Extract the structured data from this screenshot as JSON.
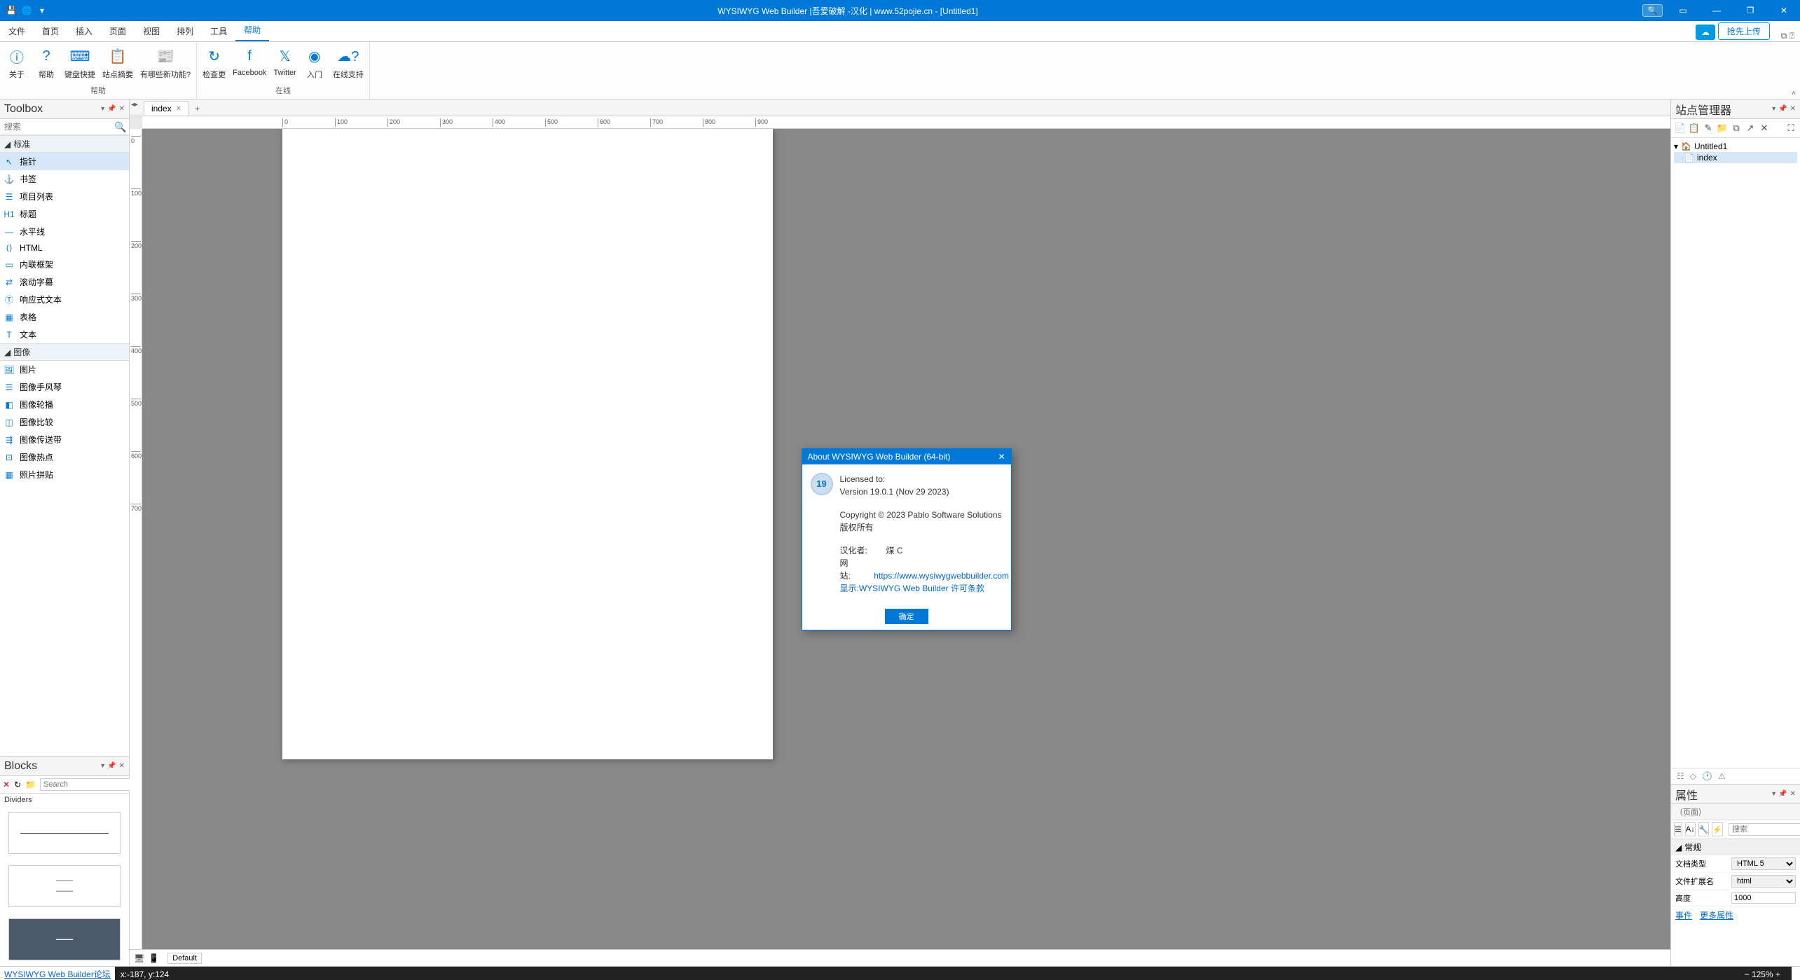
{
  "titlebar": {
    "title": "WYSIWYG Web Builder |吾爱破解 -汉化 | www.52pojie.cn - [Untitled1]"
  },
  "menu": {
    "file": "文件",
    "home": "首页",
    "insert": "插入",
    "page": "页面",
    "view": "视图",
    "arrange": "排列",
    "tools": "工具",
    "help": "帮助",
    "upload_label": "抢先上传"
  },
  "ribbon": {
    "group_help": "帮助",
    "group_online": "在线",
    "about": "关于",
    "help": "帮助",
    "shortcuts": "键盘快捷",
    "summary": "站点摘要",
    "whatsnew": "有哪些新功能?",
    "checkupdate": "检查更",
    "facebook": "Facebook",
    "twitter": "Twitter",
    "getting": "入门",
    "support": "在线支持"
  },
  "toolbox": {
    "title": "Toolbox",
    "search_ph": "搜索",
    "cat_standard": "标准",
    "pointer": "指针",
    "bookmark": "书签",
    "bulletlist": "项目列表",
    "heading": "标题",
    "hr": "水平线",
    "html": "HTML",
    "iframe": "内联框架",
    "marquee": "滚动字幕",
    "responsive": "响应式文本",
    "table": "表格",
    "text": "文本",
    "cat_images": "图像",
    "image": "图片",
    "accordion": "图像手风琴",
    "carousel": "图像轮播",
    "compare": "图像比较",
    "conveyor": "图像传送带",
    "hotspot": "图像热点",
    "collage": "照片拼贴"
  },
  "blocks": {
    "title": "Blocks",
    "search_ph": "Search",
    "cat": "Dividers"
  },
  "tabs": {
    "index": "index"
  },
  "site_manager": {
    "title": "站点管理器",
    "root": "Untitled1",
    "page": "index"
  },
  "properties": {
    "title": "属性",
    "subtitle": "（页面）",
    "search_ph": "搜索",
    "cat_general": "常规",
    "doctype_label": "文档类型",
    "doctype_value": "HTML 5",
    "ext_label": "文件扩展名",
    "ext_value": "html",
    "height_label": "高度",
    "height_value": "1000",
    "events_link": "事件",
    "more_link": "更多属性"
  },
  "dialog": {
    "title": "About WYSIWYG Web Builder  (64-bit)",
    "icon_text": "19",
    "licensed": "Licensed to:",
    "version": "Version 19.0.1 (Nov 29 2023)",
    "copyright": "Copyright © 2023 Pablo Software Solutions",
    "rights": "版权所有",
    "translator_label": "汉化者:",
    "translator": "煤 C",
    "website_label": "网站:",
    "website": "https://www.wysiwygwebbuilder.com",
    "license_hint": "显示:WYSIWYG Web Builder 许可条款",
    "ok": "确定"
  },
  "statusbar": {
    "forum_link": "WYSIWYG Web Builder论坛",
    "default_btn": "Default",
    "coords": "x:-187, y:124",
    "zoom": "125%"
  },
  "ruler_h": [
    "0",
    "100",
    "200",
    "300",
    "400",
    "500",
    "600",
    "700",
    "800",
    "900"
  ],
  "ruler_v": [
    "0",
    "100",
    "200",
    "300",
    "400",
    "500",
    "600",
    "700"
  ]
}
